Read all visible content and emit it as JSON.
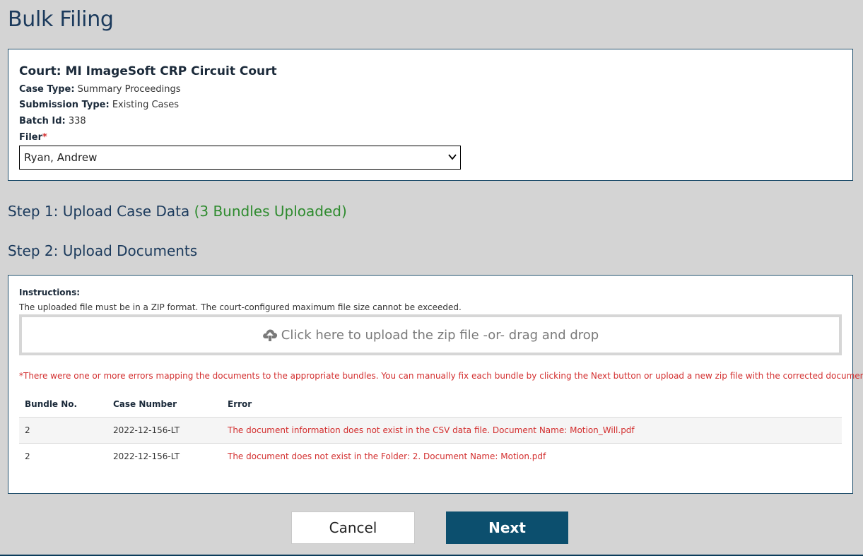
{
  "page": {
    "title": "Bulk Filing"
  },
  "court_info": {
    "court_title": "Court: MI ImageSoft CRP Circuit Court",
    "case_type_label": "Case Type:",
    "case_type_value": "Summary Proceedings",
    "submission_type_label": "Submission Type:",
    "submission_type_value": "Existing Cases",
    "batch_id_label": "Batch Id:",
    "batch_id_value": "338",
    "filer_label": "Filer",
    "filer_required_mark": "*",
    "filer_selected": "Ryan, Andrew"
  },
  "step1": {
    "label": "Step 1: Upload Case Data",
    "status": "(3 Bundles Uploaded)"
  },
  "step2": {
    "label": "Step 2: Upload Documents"
  },
  "documents": {
    "instructions_title": "Instructions:",
    "instructions_text": "The uploaded file must be in a ZIP format. The court-configured maximum file size cannot be exceeded.",
    "upload_label": "Click here to upload the zip file -or- drag and drop",
    "error_message": "*There were one or more errors mapping the documents to the appropriate bundles. You can manually fix each bundle by clicking the Next button or upload a new zip file with the corrected documents.*",
    "table": {
      "headers": [
        "Bundle No.",
        "Case Number",
        "Error"
      ],
      "rows": [
        [
          "2",
          "2022-12-156-LT",
          "The document information does not exist in the CSV data file. Document Name: Motion_Will.pdf"
        ],
        [
          "2",
          "2022-12-156-LT",
          "The document does not exist in the Folder: 2. Document Name: Motion.pdf"
        ]
      ]
    }
  },
  "actions": {
    "cancel_label": "Cancel",
    "next_label": "Next"
  },
  "colors": {
    "accent": "#0c4f6e",
    "error": "#d32f2f",
    "success": "#2e8b2e",
    "title": "#1b3a5c"
  },
  "icons": {
    "upload": "cloud-upload-icon",
    "select": "chevron-down-icon"
  }
}
